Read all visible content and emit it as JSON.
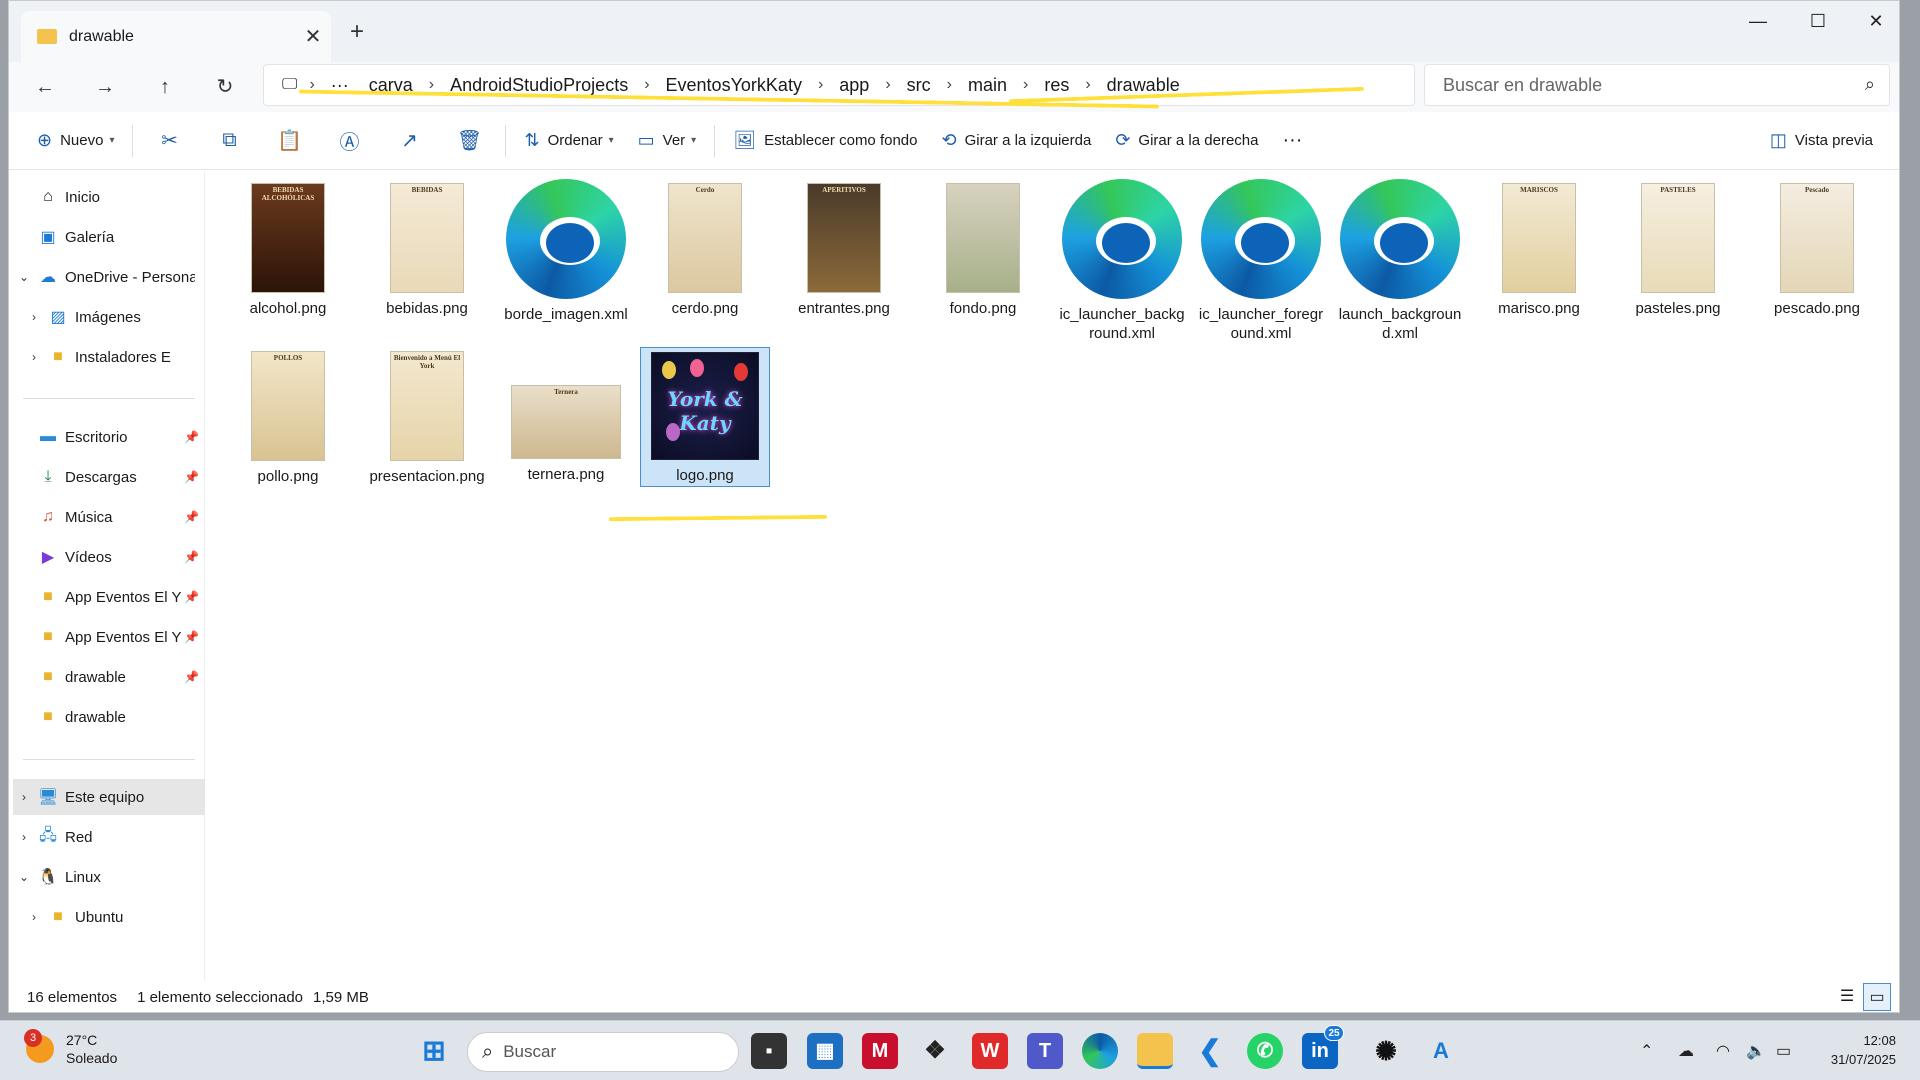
{
  "window": {
    "tab_title": "drawable",
    "controls": {
      "minimize": "—",
      "maximize": "☐",
      "close": "✕"
    }
  },
  "nav": {
    "breadcrumbs": [
      "carva",
      "AndroidStudioProjects",
      "EventosYorkKaty",
      "app",
      "src",
      "main",
      "res",
      "drawable"
    ],
    "more": "···",
    "search_placeholder": "Buscar en drawable"
  },
  "commands": {
    "new": "Nuevo",
    "sort": "Ordenar",
    "view": "Ver",
    "set_background": "Establecer como fondo",
    "rotate_left": "Girar a la izquierda",
    "rotate_right": "Girar a la derecha",
    "more": "···",
    "preview": "Vista previa"
  },
  "sidebar": {
    "items": [
      {
        "label": "Inicio",
        "icon": "home-icon"
      },
      {
        "label": "Galería",
        "icon": "gallery-icon"
      },
      {
        "label": "OneDrive - Persona",
        "icon": "onedrive-icon"
      },
      {
        "label": "Imágenes",
        "icon": "pictures-icon"
      },
      {
        "label": "Instaladores E",
        "icon": "folder-icon"
      },
      {
        "label": "Escritorio",
        "icon": "desktop-icon"
      },
      {
        "label": "Descargas",
        "icon": "download-icon"
      },
      {
        "label": "Música",
        "icon": "music-icon"
      },
      {
        "label": "Vídeos",
        "icon": "video-icon"
      },
      {
        "label": "App Eventos El Y",
        "icon": "folder-icon"
      },
      {
        "label": "App Eventos El Y",
        "icon": "folder-icon"
      },
      {
        "label": "drawable",
        "icon": "folder-icon"
      },
      {
        "label": "drawable",
        "icon": "folder-icon"
      },
      {
        "label": "Este equipo",
        "icon": "computer-icon"
      },
      {
        "label": "Red",
        "icon": "network-icon"
      },
      {
        "label": "Linux",
        "icon": "linux-icon"
      },
      {
        "label": "Ubuntu",
        "icon": "folder-icon"
      }
    ]
  },
  "files": [
    {
      "name": "alcohol.png",
      "kind": "image",
      "thumb_text": "BEBIDAS ALCOHÓLICAS"
    },
    {
      "name": "bebidas.png",
      "kind": "image",
      "thumb_text": "BEBIDAS"
    },
    {
      "name": "borde_imagen.xml",
      "kind": "edge"
    },
    {
      "name": "cerdo.png",
      "kind": "image",
      "thumb_text": "Cerdo"
    },
    {
      "name": "entrantes.png",
      "kind": "image",
      "thumb_text": "APERITIVOS"
    },
    {
      "name": "fondo.png",
      "kind": "image",
      "thumb_text": ""
    },
    {
      "name": "ic_launcher_background.xml",
      "kind": "edge"
    },
    {
      "name": "ic_launcher_foreground.xml",
      "kind": "edge"
    },
    {
      "name": "launch_background.xml",
      "kind": "edge"
    },
    {
      "name": "marisco.png",
      "kind": "image",
      "thumb_text": "MARISCOS"
    },
    {
      "name": "pasteles.png",
      "kind": "image",
      "thumb_text": "PASTELES"
    },
    {
      "name": "pescado.png",
      "kind": "image",
      "thumb_text": "Pescado"
    },
    {
      "name": "pollo.png",
      "kind": "image",
      "thumb_text": "POLLOS"
    },
    {
      "name": "presentacion.png",
      "kind": "image",
      "thumb_text": "Bienvenido a Menú El York"
    },
    {
      "name": "ternera.png",
      "kind": "image",
      "thumb_text": "Ternera"
    },
    {
      "name": "logo.png",
      "kind": "logo",
      "thumb_text": "York & Katy",
      "selected": true
    }
  ],
  "status": {
    "count": "16 elementos",
    "selection": "1 elemento seleccionado",
    "size": "1,59 MB"
  },
  "taskbar": {
    "weather_badge": "3",
    "temperature": "27°C",
    "condition": "Soleado",
    "search": "Buscar",
    "linkedin_badge": "25",
    "time": "12:08",
    "date": "31/07/2025"
  },
  "colors": {
    "highlight_marker": "#ffe03a",
    "selection": "#cce4f7",
    "accent": "#1f5fa8"
  }
}
